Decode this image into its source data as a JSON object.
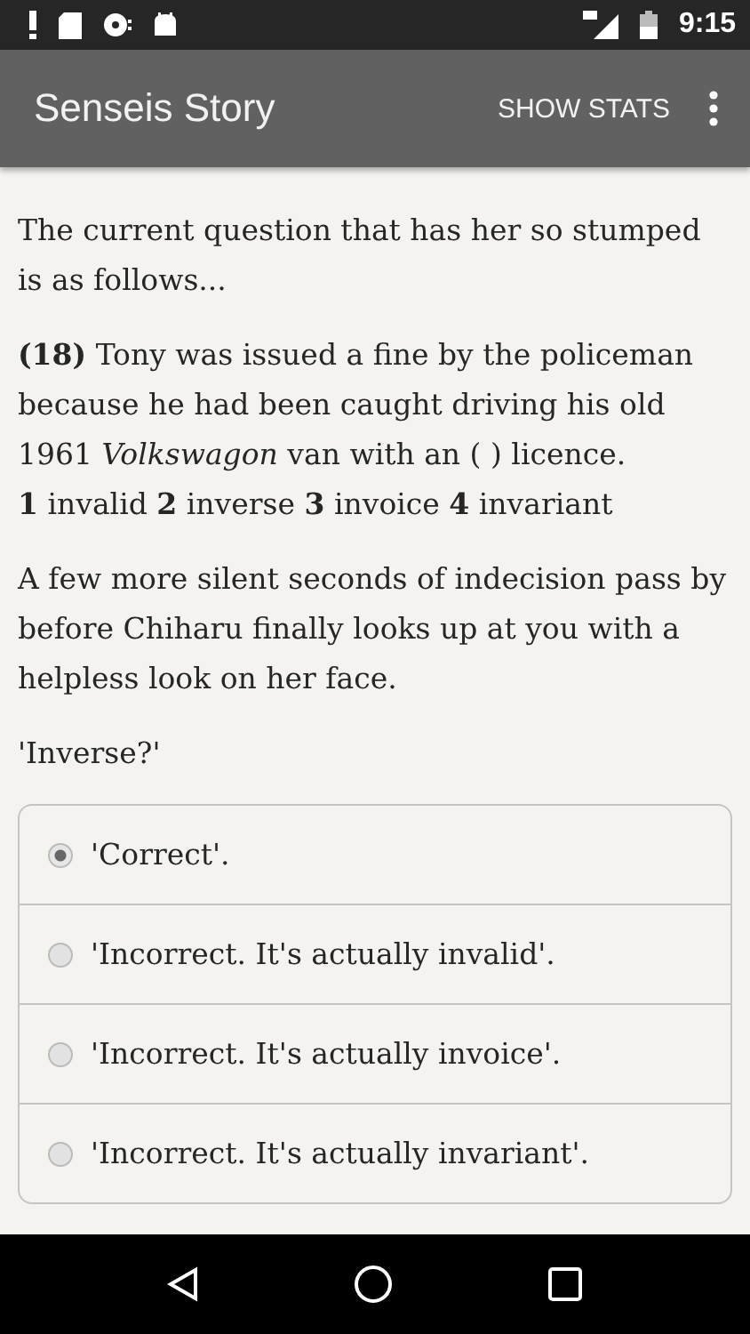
{
  "status_bar": {
    "time": "9:15"
  },
  "app_bar": {
    "title": "Senseis Story",
    "action": "SHOW STATS"
  },
  "story": [
    {
      "text": "The current question that has her so stumped is as follows..."
    },
    {
      "text": "**(18)** Tony was issued a fine by the policeman because he had been caught driving his old 1961 *Volkswagon* van with an ( ) licence.",
      "choices": "**1** invalid **2** inverse **3** invoice **4** invariant"
    },
    {
      "text": "A few more silent seconds of indecision pass by before Chiharu finally looks up at you with a helpless look on her face."
    },
    {
      "text": "'Inverse?'"
    }
  ],
  "options": [
    {
      "label": "'Correct'.",
      "selected": true
    },
    {
      "label": "'Incorrect. It's actually invalid'.",
      "selected": false
    },
    {
      "label": "'Incorrect. It's actually invoice'.",
      "selected": false
    },
    {
      "label": "'Incorrect. It's actually invariant'.",
      "selected": false
    }
  ]
}
